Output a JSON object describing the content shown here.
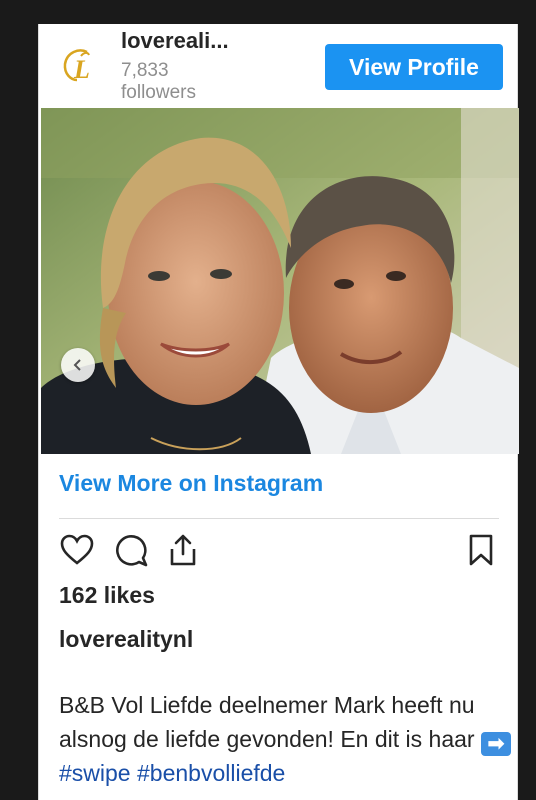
{
  "header": {
    "username": "lovereali...",
    "followers_count": "7,833",
    "followers_label": "followers",
    "view_profile_label": "View Profile",
    "logo_letter": "L"
  },
  "carousel": {
    "prev_icon": "chevron-left-icon",
    "slide_count": 2,
    "active_slide": 2
  },
  "view_more_label": "View More on Instagram",
  "actions": {
    "like_icon": "heart-icon",
    "comment_icon": "comment-icon",
    "share_icon": "share-icon",
    "save_icon": "bookmark-icon"
  },
  "likes": "162 likes",
  "owner": "loverealitynl",
  "caption": {
    "text": "B&B Vol Liefde deelnemer Mark heeft nu alsnog de liefde gevonden! En dit is haar",
    "emoji": "➡",
    "tags": [
      "#swipe",
      "#benbvolliefde"
    ]
  },
  "colors": {
    "accent": "#1b93f2",
    "link": "#1b87e0",
    "hashtag": "#1a4fa8",
    "logo_gold": "#d9a520"
  }
}
